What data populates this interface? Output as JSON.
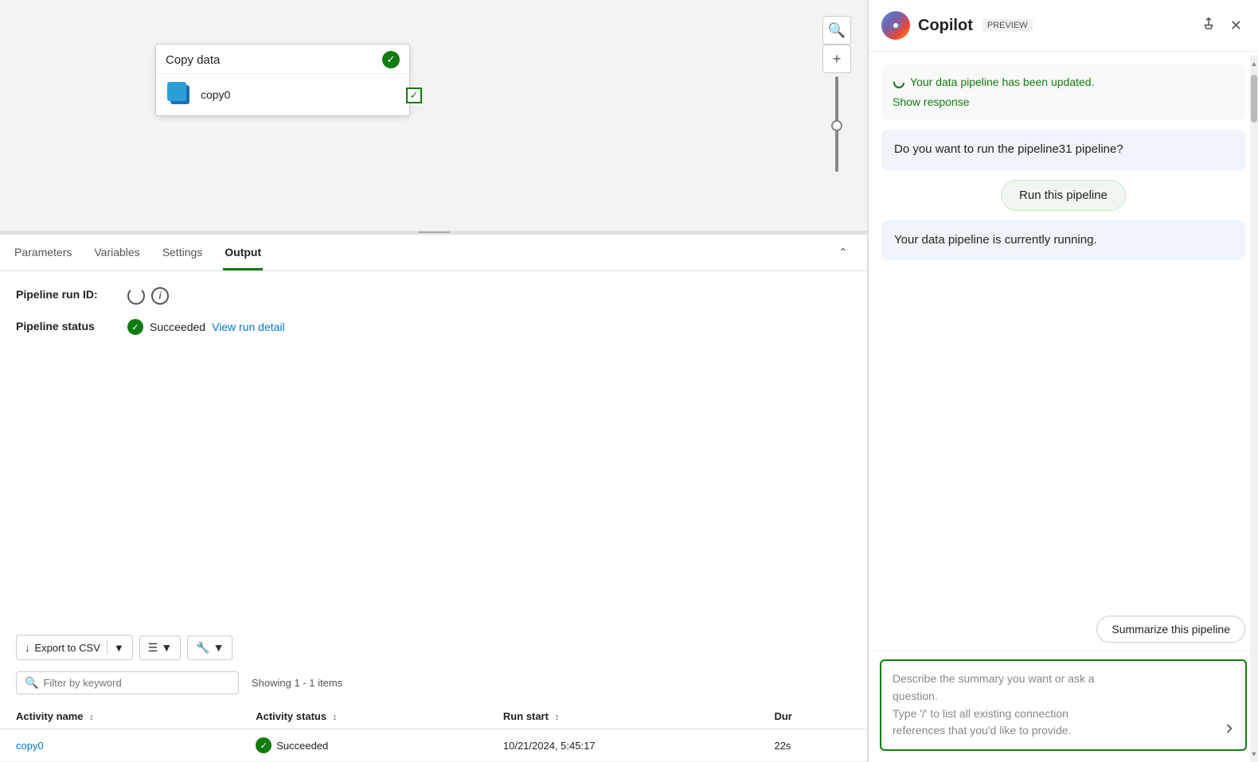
{
  "canvas": {
    "node": {
      "title": "Copy data",
      "activity_name": "copy0"
    }
  },
  "tabs": {
    "parameters": "Parameters",
    "variables": "Variables",
    "settings": "Settings",
    "output": "Output"
  },
  "output": {
    "pipeline_run_id_label": "Pipeline run ID:",
    "pipeline_status_label": "Pipeline status",
    "status_value": "Succeeded",
    "view_run_detail": "View run detail",
    "export_csv_label": "Export to CSV",
    "filter_placeholder": "Filter by keyword",
    "showing_items": "Showing 1 - 1 items",
    "table": {
      "headers": [
        "Activity name",
        "Activity status",
        "Run start",
        "Dur"
      ],
      "rows": [
        {
          "activity_name": "copy0",
          "activity_status": "Succeeded",
          "run_start": "10/21/2024, 5:45:17",
          "duration": "22s"
        }
      ]
    }
  },
  "copilot": {
    "title": "Copilot",
    "preview_badge": "PREVIEW",
    "messages": [
      {
        "type": "copilot_update",
        "pipeline_updated_text": "Your data pipeline has been updated.",
        "show_response": "Show response"
      },
      {
        "type": "question",
        "text": "Do you want to run the pipeline31 pipeline?"
      },
      {
        "type": "suggestion",
        "text": "Run this pipeline"
      },
      {
        "type": "running",
        "text": "Your data pipeline is currently running."
      }
    ],
    "summarize_btn": "Summarize this pipeline",
    "input_placeholder_line1": "Describe the summary you want or ask a",
    "input_placeholder_line2": "question.",
    "input_placeholder_line3": "Type '/' to list all existing connection",
    "input_placeholder_line4": "references that you'd like to provide."
  }
}
